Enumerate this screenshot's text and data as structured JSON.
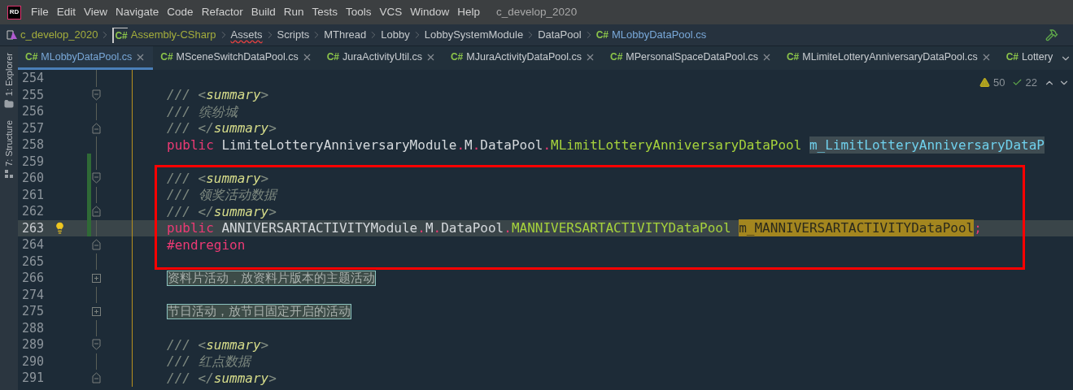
{
  "app": {
    "logo": "RD",
    "title": "c_develop_2020"
  },
  "menu": [
    "File",
    "Edit",
    "View",
    "Navigate",
    "Code",
    "Refactor",
    "Build",
    "Run",
    "Tests",
    "Tools",
    "VCS",
    "Window",
    "Help"
  ],
  "breadcrumbs": [
    {
      "kind": "solution",
      "label": "c_develop_2020"
    },
    {
      "kind": "project",
      "label": "Assembly-CSharp",
      "badge": "C#"
    },
    {
      "kind": "folder",
      "label": "Assets",
      "error": true
    },
    {
      "kind": "folder",
      "label": "Scripts",
      "error": false
    },
    {
      "kind": "folder",
      "label": "MThread",
      "error": false
    },
    {
      "kind": "folder",
      "label": "Lobby",
      "error": false
    },
    {
      "kind": "folder",
      "label": "LobbySystemModule",
      "error": false
    },
    {
      "kind": "folder",
      "label": "DataPool",
      "error": false
    },
    {
      "kind": "file",
      "label": "MLobbyDataPool.cs",
      "badge": "C#"
    }
  ],
  "side_tools": [
    "1: Explorer",
    "7: Structure"
  ],
  "tabs": [
    {
      "badge": "C#",
      "label": "MLobbyDataPool.cs",
      "selected": true,
      "close_button": true
    },
    {
      "badge": "C#",
      "label": "MSceneSwitchDataPool.cs",
      "selected": false,
      "close_button": true
    },
    {
      "badge": "C#",
      "label": "JuraActivityUtil.cs",
      "selected": false,
      "close_button": true
    },
    {
      "badge": "C#",
      "label": "MJuraActivityDataPool.cs",
      "selected": false,
      "close_button": true
    },
    {
      "badge": "C#",
      "label": "MPersonalSpaceDataPool.cs",
      "selected": false,
      "close_button": true
    },
    {
      "badge": "C#",
      "label": "MLimiteLotteryAnniversaryDataPool.cs",
      "selected": false,
      "close_button": true
    },
    {
      "badge": "C#",
      "label": "Lottery",
      "selected": false,
      "close_button": false
    }
  ],
  "inspections": {
    "warnings": "50",
    "passed": "22"
  },
  "lines": [
    {
      "number": "254",
      "fold_start": false,
      "fold_end": false,
      "collapsed": false,
      "changed": false,
      "current": false,
      "bulb": false
    },
    {
      "number": "255",
      "fold_start": true,
      "fold_end": false,
      "collapsed": false,
      "changed": false,
      "current": false,
      "bulb": false,
      "tokens": [
        {
          "kind": "comment",
          "text": "/// <"
        },
        {
          "kind": "doc-tag",
          "text": "summary"
        },
        {
          "kind": "comment",
          "text": ">"
        }
      ]
    },
    {
      "number": "256",
      "fold_start": false,
      "fold_end": false,
      "collapsed": false,
      "changed": false,
      "current": false,
      "bulb": false,
      "tokens": [
        {
          "kind": "comment",
          "text": "/// 缤纷城"
        }
      ]
    },
    {
      "number": "257",
      "fold_start": false,
      "fold_end": true,
      "collapsed": false,
      "changed": false,
      "current": false,
      "bulb": false,
      "tokens": [
        {
          "kind": "comment",
          "text": "/// </"
        },
        {
          "kind": "doc-tag",
          "text": "summary"
        },
        {
          "kind": "comment",
          "text": ">"
        }
      ]
    },
    {
      "number": "258",
      "fold_start": false,
      "fold_end": false,
      "collapsed": false,
      "changed": false,
      "current": false,
      "bulb": false,
      "tokens": [
        {
          "kind": "keyword",
          "text": "public"
        },
        {
          "kind": "plain",
          "text": " LimiteLotteryAnniversaryModule"
        },
        {
          "kind": "punct",
          "text": "."
        },
        {
          "kind": "plain",
          "text": "M"
        },
        {
          "kind": "punct",
          "text": "."
        },
        {
          "kind": "plain",
          "text": "DataPool"
        },
        {
          "kind": "punct",
          "text": "."
        },
        {
          "kind": "type",
          "text": "MLimitLotteryAnniversaryDataPool"
        },
        {
          "kind": "field-usage",
          "text": "m_LimitLotteryAnniversaryDataP"
        }
      ]
    },
    {
      "number": "259",
      "fold_start": false,
      "fold_end": false,
      "collapsed": false,
      "changed": true,
      "current": false,
      "bulb": false
    },
    {
      "number": "260",
      "fold_start": true,
      "fold_end": false,
      "collapsed": false,
      "changed": true,
      "current": false,
      "bulb": false,
      "tokens": [
        {
          "kind": "comment",
          "text": "/// <"
        },
        {
          "kind": "doc-tag",
          "text": "summary"
        },
        {
          "kind": "comment",
          "text": ">"
        }
      ]
    },
    {
      "number": "261",
      "fold_start": false,
      "fold_end": false,
      "collapsed": false,
      "changed": true,
      "current": false,
      "bulb": false,
      "tokens": [
        {
          "kind": "comment",
          "text": "/// 领奖活动数据"
        }
      ]
    },
    {
      "number": "262",
      "fold_start": false,
      "fold_end": true,
      "collapsed": false,
      "changed": true,
      "current": false,
      "bulb": false,
      "tokens": [
        {
          "kind": "comment",
          "text": "/// </"
        },
        {
          "kind": "doc-tag",
          "text": "summary"
        },
        {
          "kind": "comment",
          "text": ">"
        }
      ]
    },
    {
      "number": "263",
      "fold_start": false,
      "fold_end": false,
      "collapsed": false,
      "changed": true,
      "current": true,
      "bulb": true,
      "tokens": [
        {
          "kind": "keyword",
          "text": "public"
        },
        {
          "kind": "plain",
          "text": " ANNIVERSARTACTIVITYModule"
        },
        {
          "kind": "punct",
          "text": "."
        },
        {
          "kind": "plain",
          "text": "M"
        },
        {
          "kind": "punct",
          "text": "."
        },
        {
          "kind": "plain",
          "text": "DataPool"
        },
        {
          "kind": "punct",
          "text": "."
        },
        {
          "kind": "type",
          "text": "MANNIVERSARTACTIVITYDataPool"
        },
        {
          "kind": "field-write",
          "text": "m_MANNIVERSARTACTIVITYDataPool"
        },
        {
          "kind": "punct",
          "text": ";"
        }
      ]
    },
    {
      "number": "264",
      "fold_start": false,
      "fold_end": true,
      "collapsed": false,
      "changed": false,
      "current": false,
      "bulb": false,
      "tokens": [
        {
          "kind": "keyword",
          "text": "#endregion"
        }
      ]
    },
    {
      "number": "265",
      "fold_start": false,
      "fold_end": false,
      "collapsed": false,
      "changed": false,
      "current": false,
      "bulb": false
    },
    {
      "number": "266",
      "fold_start": false,
      "fold_end": false,
      "collapsed": true,
      "changed": false,
      "current": false,
      "bulb": false,
      "tokens": [
        {
          "kind": "folded",
          "text": "资料片活动，放资料片版本的主题活动"
        }
      ]
    },
    {
      "number": "274",
      "fold_start": false,
      "fold_end": false,
      "collapsed": false,
      "changed": false,
      "current": false,
      "bulb": false
    },
    {
      "number": "275",
      "fold_start": false,
      "fold_end": false,
      "collapsed": true,
      "changed": false,
      "current": false,
      "bulb": false,
      "tokens": [
        {
          "kind": "folded",
          "text": "节日活动，放节日固定开启的活动"
        }
      ]
    },
    {
      "number": "288",
      "fold_start": false,
      "fold_end": false,
      "collapsed": false,
      "changed": false,
      "current": false,
      "bulb": false
    },
    {
      "number": "289",
      "fold_start": true,
      "fold_end": false,
      "collapsed": false,
      "changed": false,
      "current": false,
      "bulb": false,
      "tokens": [
        {
          "kind": "comment",
          "text": "/// <"
        },
        {
          "kind": "doc-tag",
          "text": "summary"
        },
        {
          "kind": "comment",
          "text": ">"
        }
      ]
    },
    {
      "number": "290",
      "fold_start": false,
      "fold_end": false,
      "collapsed": false,
      "changed": false,
      "current": false,
      "bulb": false,
      "tokens": [
        {
          "kind": "comment",
          "text": "/// 红点数据"
        }
      ]
    },
    {
      "number": "291",
      "fold_start": false,
      "fold_end": true,
      "collapsed": false,
      "changed": false,
      "current": false,
      "bulb": false,
      "tokens": [
        {
          "kind": "comment",
          "text": "/// </"
        },
        {
          "kind": "doc-tag",
          "text": "summary"
        },
        {
          "kind": "comment",
          "text": ">"
        }
      ]
    }
  ],
  "annotation": {
    "color": "#ff0000"
  }
}
